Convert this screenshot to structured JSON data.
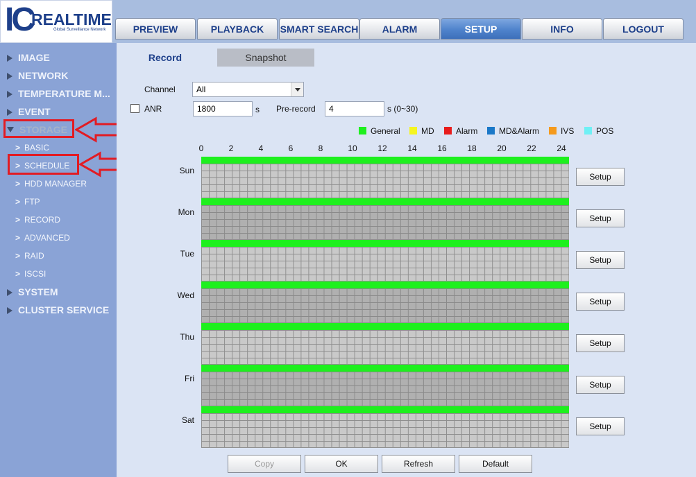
{
  "logo": {
    "ic": "IC",
    "brand": "REALTIME",
    "tagline": "Global Surveillance Network"
  },
  "nav": {
    "tabs": [
      {
        "label": "PREVIEW",
        "active": false
      },
      {
        "label": "PLAYBACK",
        "active": false
      },
      {
        "label": "SMART SEARCH",
        "active": false
      },
      {
        "label": "ALARM",
        "active": false
      },
      {
        "label": "SETUP",
        "active": true
      },
      {
        "label": "INFO",
        "active": false
      },
      {
        "label": "LOGOUT",
        "active": false
      }
    ]
  },
  "sidebar": {
    "sections": [
      {
        "label": "IMAGE"
      },
      {
        "label": "NETWORK"
      },
      {
        "label": "TEMPERATURE M..."
      },
      {
        "label": "EVENT"
      },
      {
        "label": "STORAGE"
      },
      {
        "label": "SYSTEM"
      },
      {
        "label": "CLUSTER SERVICE"
      }
    ],
    "storage_items": [
      {
        "label": "BASIC"
      },
      {
        "label": "SCHEDULE"
      },
      {
        "label": "HDD MANAGER"
      },
      {
        "label": "FTP"
      },
      {
        "label": "RECORD"
      },
      {
        "label": "ADVANCED"
      },
      {
        "label": "RAID"
      },
      {
        "label": "ISCSI"
      }
    ]
  },
  "content_tabs": {
    "record": "Record",
    "snapshot": "Snapshot"
  },
  "form": {
    "channel_label": "Channel",
    "channel_value": "All",
    "anr_label": "ANR",
    "anr_value": "1800",
    "anr_unit": "s",
    "prerecord_label": "Pre-record",
    "prerecord_value": "4",
    "prerecord_unit": "s (0~30)"
  },
  "legend": [
    {
      "label": "General",
      "color": "#1ef01e"
    },
    {
      "label": "MD",
      "color": "#f5f520"
    },
    {
      "label": "Alarm",
      "color": "#e81c1c"
    },
    {
      "label": "MD&Alarm",
      "color": "#1a78c8"
    },
    {
      "label": "IVS",
      "color": "#f59a1c"
    },
    {
      "label": "POS",
      "color": "#6ff0f5"
    }
  ],
  "schedule": {
    "hours": [
      "0",
      "2",
      "4",
      "6",
      "8",
      "10",
      "12",
      "14",
      "16",
      "18",
      "20",
      "22",
      "24"
    ],
    "days": [
      "Sun",
      "Mon",
      "Tue",
      "Wed",
      "Thu",
      "Fri",
      "Sat"
    ],
    "setup_label": "Setup"
  },
  "footer": {
    "copy": "Copy",
    "ok": "OK",
    "refresh": "Refresh",
    "default": "Default"
  }
}
